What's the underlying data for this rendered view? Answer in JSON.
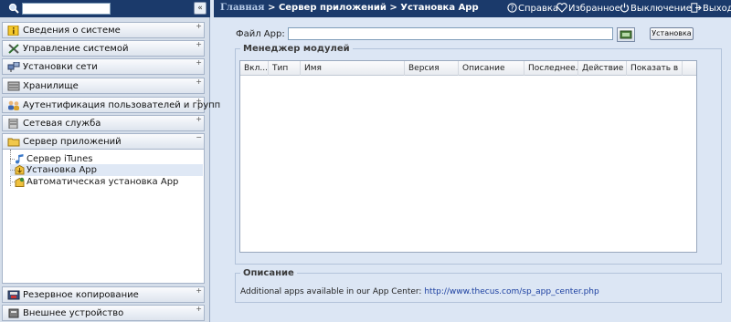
{
  "sidebar": {
    "search": {
      "value": "",
      "placeholder": ""
    },
    "collapse_glyph": "«",
    "nav_sections": [
      {
        "label": "Сведения о системе",
        "icon": "info-icon",
        "toggle": "+"
      },
      {
        "label": "Управление системой",
        "icon": "tools-icon",
        "toggle": "+"
      },
      {
        "label": "Установки сети",
        "icon": "network-icon",
        "toggle": "+"
      },
      {
        "label": "Хранилище",
        "icon": "storage-icon",
        "toggle": "+"
      },
      {
        "label": "Аутентификация пользователей и групп",
        "icon": "users-icon",
        "toggle": "+"
      },
      {
        "label": "Сетевая служба",
        "icon": "network-service-icon",
        "toggle": "+"
      },
      {
        "label": "Сервер приложений",
        "icon": "app-server-icon",
        "toggle": "−",
        "expanded": true
      },
      {
        "label": "Резервное копирование",
        "icon": "backup-icon",
        "toggle": "+"
      },
      {
        "label": "Внешнее устройство",
        "icon": "external-device-icon",
        "toggle": "+"
      }
    ],
    "app_server_items": [
      {
        "label": "Сервер iTunes",
        "icon": "itunes-icon"
      },
      {
        "label": "Установка App",
        "icon": "install-app-icon",
        "selected": true
      },
      {
        "label": "Автоматическая установка App",
        "icon": "auto-install-icon"
      }
    ]
  },
  "topbar": {
    "breadcrumb": {
      "home": "Главная",
      "sep": ">",
      "section": "Сервер приложений",
      "page": "Установка App"
    },
    "help": "Справка",
    "favorites": "Избранное",
    "shutdown": "Выключение",
    "logout": "Выход"
  },
  "form": {
    "file_label": "Файл App:",
    "file_value": "",
    "install_button": "Установка"
  },
  "module_manager": {
    "title": "Менеджер модулей",
    "columns": [
      "Вкл...",
      "Тип",
      "Имя",
      "Версия",
      "Описание",
      "Последнее...",
      "Действие",
      "Показать в ..."
    ],
    "rows": []
  },
  "description": {
    "title": "Описание",
    "text": "Additional apps available in our App Center:",
    "link": "http://www.thecus.com/sp_app_center.php"
  }
}
